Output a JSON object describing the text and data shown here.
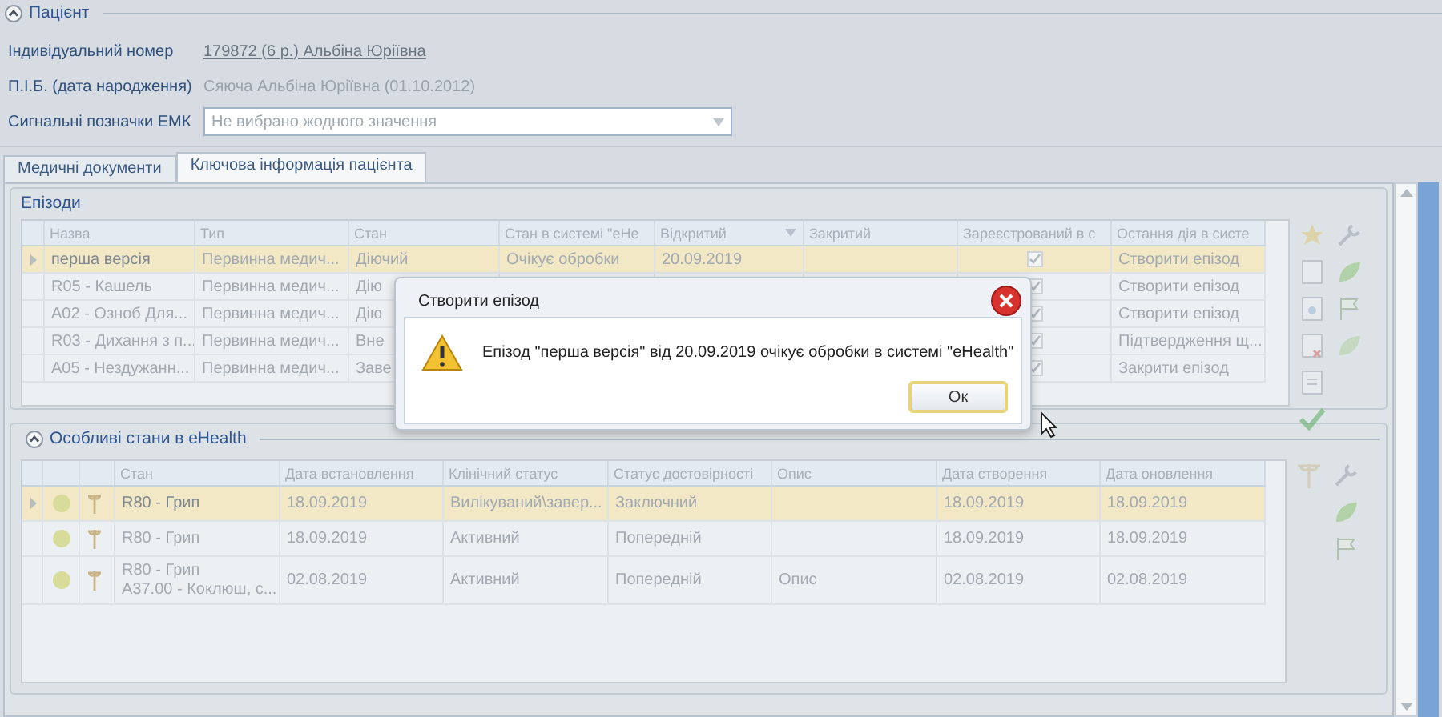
{
  "patient": {
    "title": "Пацієнт",
    "expanded": true,
    "fields": [
      {
        "kind": "link",
        "label": "Індивідуальний номер",
        "value": "179872 (6 р.) Альбіна Юріївна"
      },
      {
        "kind": "text",
        "label": "П.І.Б. (дата народження)",
        "value": "Сяюча Альбіна Юріївна (01.10.2012)"
      },
      {
        "kind": "select",
        "label": "Сигнальні позначки ЕМК",
        "placeholder": "Не вибрано жодного значення"
      }
    ]
  },
  "tabs": [
    {
      "label": "Медичні документи",
      "selected": false
    },
    {
      "label": "Ключова інформація пацієнта",
      "selected": true
    }
  ],
  "episodes": {
    "title": "Епізоди",
    "columns": [
      {
        "label": "Назва",
        "sorted": false
      },
      {
        "label": "Тип",
        "sorted": false
      },
      {
        "label": "Стан",
        "sorted": false
      },
      {
        "label": "Стан в системі \"eHe",
        "sorted": false
      },
      {
        "label": "Відкритий",
        "sorted": true
      },
      {
        "label": "Закритий",
        "sorted": false
      },
      {
        "label": "Зареєстрований в с",
        "sorted": false
      },
      {
        "label": "Остання дія в систе",
        "sorted": false
      }
    ],
    "rows": [
      {
        "selected": true,
        "name": "перша версія",
        "type": "Первинна медич...",
        "state": "Діючий",
        "ehealth_state": "Очікує обробки",
        "opened": "20.09.2019",
        "registered": true,
        "last_action": "Створити епізод"
      },
      {
        "selected": false,
        "name": "R05 - Кашель",
        "type": "Первинна медич...",
        "state": "Дію",
        "registered": true,
        "last_action": "Створити епізод"
      },
      {
        "selected": false,
        "name": "A02 - Озноб Для...",
        "type": "Первинна медич...",
        "state": "Дію",
        "registered": true,
        "last_action": "Створити епізод"
      },
      {
        "selected": false,
        "name": "R03 - Дихання з п...",
        "type": "Первинна медич...",
        "state": "Вне",
        "registered": true,
        "last_action": "Підтвердження щ..."
      },
      {
        "selected": false,
        "name": "A05 - Нездужанн...",
        "type": "Первинна медич...",
        "state": "Заве",
        "registered": true,
        "last_action": "Закрити епізод"
      }
    ]
  },
  "conditions": {
    "title": "Особливі стани в eHealth",
    "expanded": true,
    "columns": [
      "Стан",
      "Дата встановлення",
      "Клінічний статус",
      "Статус достовірності",
      "Опис",
      "Дата створення",
      "Дата оновлення"
    ],
    "rows": [
      {
        "selected": true,
        "condition": "R80 - Грип",
        "established": "18.09.2019",
        "clinical_status": "Вилікуваний\\завер...",
        "verification_status": "Заключний",
        "created": "18.09.2019",
        "updated": "18.09.2019"
      },
      {
        "selected": false,
        "condition": "R80 - Грип",
        "established": "18.09.2019",
        "clinical_status": "Активний",
        "verification_status": "Попередній",
        "created": "18.09.2019",
        "updated": "18.09.2019"
      },
      {
        "selected": false,
        "condition": "R80 - Грип\nA37.00 - Коклюш, с...",
        "established": "02.08.2019",
        "clinical_status": "Активний",
        "verification_status": "Попередній",
        "description": "Опис",
        "created": "02.08.2019",
        "updated": "02.08.2019"
      }
    ]
  },
  "dialog": {
    "kind": "warning",
    "title": "Створити епізод",
    "message": "Епізод \"перша версія\" від 20.09.2019 очікує обробки в системі \"eHealth\"",
    "button": "Ок"
  }
}
